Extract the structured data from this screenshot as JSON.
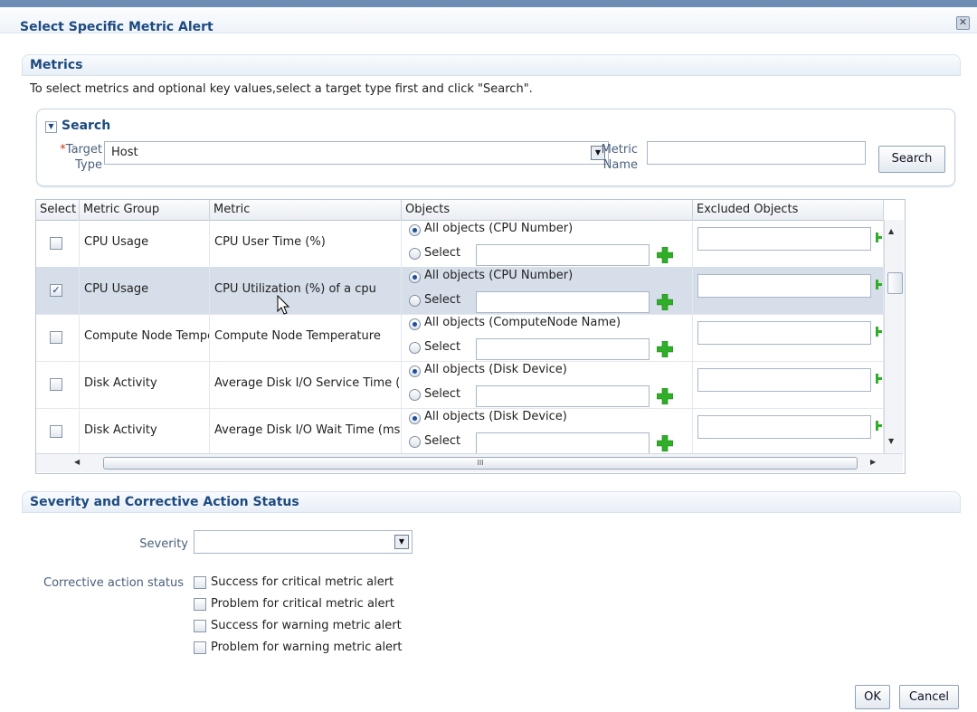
{
  "dialog": {
    "title": "Select Specific Metric Alert",
    "close_icon": "close-icon"
  },
  "metrics": {
    "heading": "Metrics",
    "description": "To select metrics and optional key values,select a target type first and click \"Search\".",
    "search": {
      "heading": "Search",
      "collapse_icon": "chevron-down-icon",
      "required_marker": "*",
      "target_type_label": "Target Type",
      "target_type_value": "Host",
      "metric_name_label": "Metric Name",
      "metric_name_value": "",
      "search_button": "Search"
    },
    "table": {
      "columns": [
        "Select",
        "Metric Group",
        "Metric",
        "Objects",
        "Excluded Objects"
      ],
      "select_radio_label": "Select",
      "rows": [
        {
          "checked": false,
          "metric_group": "CPU Usage",
          "metric": "CPU User Time (%)",
          "objects_option": "All objects (CPU Number)"
        },
        {
          "checked": true,
          "metric_group": "CPU Usage",
          "metric": "CPU Utilization (%) of a cpu",
          "objects_option": "All objects (CPU Number)"
        },
        {
          "checked": false,
          "metric_group": "Compute Node Temperature",
          "metric": "Compute Node Temperature",
          "objects_option": "All objects (ComputeNode Name)"
        },
        {
          "checked": false,
          "metric_group": "Disk Activity",
          "metric": "Average Disk I/O Service Time (ms)",
          "objects_option": "All objects (Disk Device)"
        },
        {
          "checked": false,
          "metric_group": "Disk Activity",
          "metric": "Average Disk I/O Wait Time (ms)",
          "objects_option": "All objects (Disk Device)"
        }
      ],
      "hscroll_grip": "III"
    }
  },
  "severity_section": {
    "heading": "Severity and Corrective Action Status",
    "severity_label": "Severity",
    "severity_value": "",
    "corrective_action_label": "Corrective action status",
    "corrective_options": [
      "Success for critical metric alert",
      "Problem for critical metric alert",
      "Success for warning metric alert",
      "Problem for warning metric alert"
    ]
  },
  "footer": {
    "ok": "OK",
    "cancel": "Cancel"
  },
  "colors": {
    "heading_blue": "#1c4a80",
    "plus_green": "#2fae27",
    "selected_row": "#d6dee9"
  }
}
